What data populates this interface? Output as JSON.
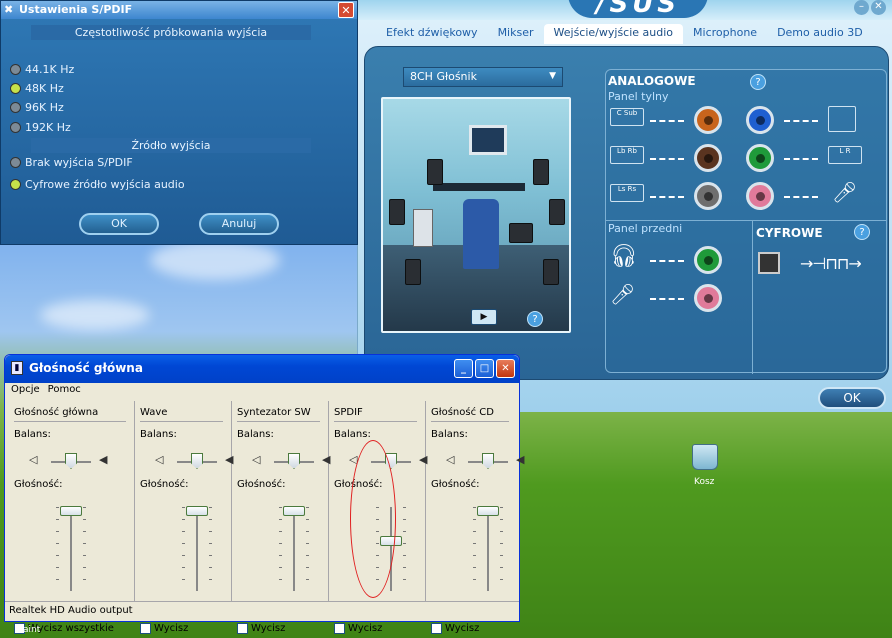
{
  "spdif": {
    "title": "Ustawienia S/PDIF",
    "sample_rate_header": "Częstotliwość próbkowania wyjścia",
    "rates": [
      {
        "label": "44.1K Hz",
        "selected": false
      },
      {
        "label": "48K Hz",
        "selected": true
      },
      {
        "label": "96K Hz",
        "selected": false
      },
      {
        "label": "192K Hz",
        "selected": false
      }
    ],
    "source_header": "Źródło wyjścia",
    "sources": [
      {
        "label": "Brak wyjścia S/PDIF",
        "selected": false
      },
      {
        "label": "Cyfrowe źródło wyjścia audio",
        "selected": true
      }
    ],
    "ok_label": "OK",
    "cancel_label": "Anuluj"
  },
  "asus": {
    "logo": "/SUS",
    "tabs": [
      "Efekt dźwiękowy",
      "Mikser",
      "Wejście/wyjście audio",
      "Microphone",
      "Demo audio 3D"
    ],
    "active_tab": "Wejście/wyjście audio",
    "speaker_select": "8CH Głośnik",
    "analog_header": "ANALOGOWE",
    "rear_panel_label": "Panel tylny",
    "front_panel_label": "Panel przedni",
    "digital_header": "CYFROWE",
    "jack_icons": {
      "c_sub": "C Sub",
      "lb_rb": "Lb Rb",
      "ls_rs": "Ls Rs",
      "l_r": "L R"
    },
    "jack_colors": [
      "#c8641c",
      "#5a3420",
      "#6f6f6f",
      "#1f5fd0",
      "#1f9a3a",
      "#e07a9a",
      "#1f9a3a",
      "#e07a9a"
    ],
    "ok_label": "OK"
  },
  "volume": {
    "title": "Głośność główna",
    "menu": [
      "Opcje",
      "Pomoc"
    ],
    "balance_label": "Balans:",
    "volume_label": "Głośność:",
    "channels": [
      {
        "name": "Głośność główna",
        "mute": "Wycisz wszystkie",
        "balance": 0.5,
        "level": 0.95
      },
      {
        "name": "Wave",
        "mute": "Wycisz",
        "balance": 0.5,
        "level": 0.95
      },
      {
        "name": "Syntezator SW",
        "mute": "Wycisz",
        "balance": 0.5,
        "level": 0.95
      },
      {
        "name": "SPDIF",
        "mute": "Wycisz",
        "balance": 0.5,
        "level": 0.6
      },
      {
        "name": "Głośność CD",
        "mute": "Wycisz",
        "balance": 0.5,
        "level": 0.95
      }
    ],
    "status": "Realtek HD Audio output"
  },
  "desktop": {
    "recycle_bin": "Kosz",
    "paint": "Paint"
  }
}
